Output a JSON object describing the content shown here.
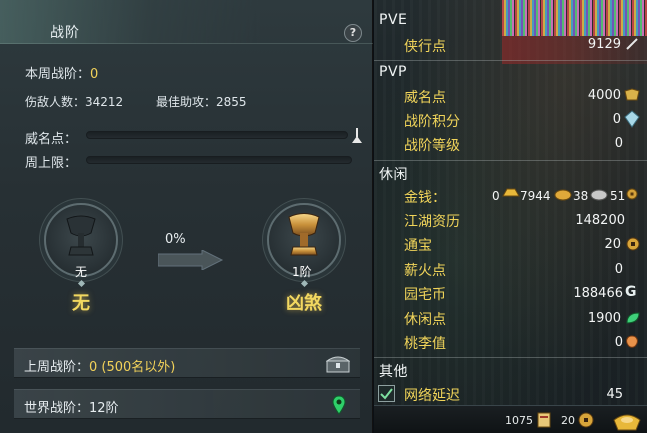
{
  "left": {
    "title": "战阶",
    "help_label": "?",
    "weekly_rank_label": "本周战阶：",
    "weekly_rank_value": "0",
    "enemies_label": "伤敌人数：34212",
    "best_assist_label": "最佳助攻：2855",
    "prestige_label": "威名点：",
    "weekly_cap_label": "周上限：",
    "prestige_progress": 0,
    "weekly_cap_progress": 0,
    "current_rank": {
      "level": "无",
      "name": "无"
    },
    "next_rank": {
      "level": "1阶",
      "name": "凶煞"
    },
    "advance_percent": "0%",
    "last_week_label": "上周战阶：",
    "last_week_value": "0 (500名以外)",
    "world_rank_label": "世界战阶：12阶",
    "icons": {
      "help": "help-icon",
      "chest": "chest-icon",
      "location": "map-pin-icon",
      "marker": "bar-marker-icon"
    }
  },
  "right": {
    "sections": {
      "pve": "PVE",
      "pvp": "PVP",
      "leisure": "休闲",
      "other": "其他"
    },
    "pve_items": [
      {
        "label": "侠行点",
        "value": "9129",
        "icon": "feather-icon"
      }
    ],
    "pvp_items": [
      {
        "label": "威名点",
        "value": "4000",
        "icon": "badge-icon"
      },
      {
        "label": "战阶积分",
        "value": "0",
        "icon": "crystal-icon"
      },
      {
        "label": "战阶等级",
        "value": "0",
        "icon": ""
      }
    ],
    "money": {
      "label": "金钱：",
      "value0": "0",
      "gold": "7944",
      "silver": "38",
      "copper": "51"
    },
    "leisure_items": [
      {
        "label": "江湖资历",
        "value": "148200",
        "icon": ""
      },
      {
        "label": "通宝",
        "value": "20",
        "icon": "coin-icon"
      },
      {
        "label": "薪火点",
        "value": "0",
        "icon": ""
      },
      {
        "label": "园宅币",
        "value": "188466",
        "icon": "house-coin-icon"
      },
      {
        "label": "休闲点",
        "value": "1900",
        "icon": "leaf-icon"
      },
      {
        "label": "桃李值",
        "value": "0",
        "icon": "peach-icon"
      }
    ],
    "other_items": [
      {
        "label": "网络延迟",
        "value": "45",
        "checked": true
      }
    ],
    "bottom": {
      "scroll_count": "1075",
      "coin_count": "20"
    },
    "colors": {
      "label": "#f0d45a",
      "value": "#f3f5f5",
      "accent_green": "#3fd07a"
    }
  }
}
